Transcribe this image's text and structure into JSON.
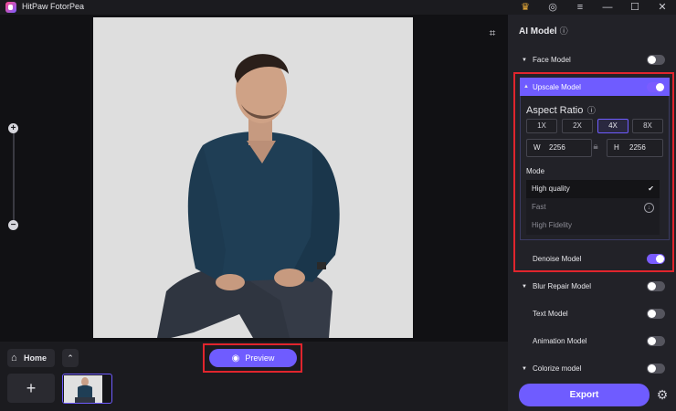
{
  "app": {
    "title": "HitPaw FotorPea"
  },
  "titlebar": {
    "icons": [
      "crown-icon",
      "user-icon",
      "menu-icon",
      "minimize-icon",
      "maximize-icon",
      "close-icon"
    ]
  },
  "canvas": {
    "zoom": {
      "plus": "+",
      "minus": "−"
    },
    "icons": [
      "crop-icon",
      "zoom-in-icon",
      "zoom-out-icon"
    ]
  },
  "bottom": {
    "home_label": "Home",
    "collapse_glyph": "⌃",
    "add_glyph": "+",
    "preview_label": "Preview"
  },
  "panel": {
    "title": "AI Model",
    "face_model": {
      "label": "Face Model",
      "enabled": false
    },
    "upscale_model": {
      "label": "Upscale Model",
      "enabled": true,
      "aspect_title": "Aspect Ratio",
      "ratios": [
        "1X",
        "2X",
        "4X",
        "8X"
      ],
      "selected_ratio": "4X",
      "width_label": "W",
      "width_value": "2256",
      "height_label": "H",
      "height_value": "2256",
      "mode_label": "Mode",
      "modes": [
        "High quality",
        "Fast",
        "High Fidelity"
      ],
      "selected_mode": "High quality"
    },
    "denoise_model": {
      "label": "Denoise Model",
      "enabled": true
    },
    "blur_repair_model": {
      "label": "Blur Repair Model",
      "enabled": false
    },
    "text_model": {
      "label": "Text Model",
      "enabled": false
    },
    "animation_model": {
      "label": "Animation Model",
      "enabled": false
    },
    "colorize_model": {
      "label": "Colorize model",
      "enabled": false
    },
    "export_label": "Export"
  },
  "colors": {
    "accent": "#6f5cff",
    "highlight_frame": "#e0252d",
    "panel_bg": "#222228",
    "app_bg": "#1b1b1f"
  }
}
